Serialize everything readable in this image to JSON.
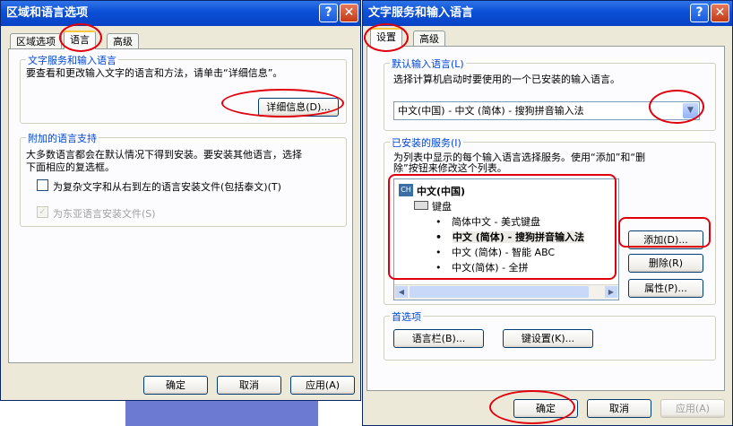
{
  "left_window": {
    "title": "区域和语言选项",
    "help_glyph": "?",
    "close_glyph": "✕",
    "tabs": [
      "区域选项",
      "语言",
      "高级"
    ],
    "group1": {
      "legend": "文字服务和输入语言",
      "desc": "要查看和更改输入文字的语言和方法，请单击“详细信息”。",
      "details_button": "详细信息(D)..."
    },
    "group2": {
      "legend": "附加的语言支持",
      "desc_line1": "大多数语言都会在默认情况下得到安装。要安装其他语言，选择",
      "desc_line2": "下面相应的复选框。",
      "checkbox1": "为复杂文字和从右到左的语言安装文件(包括泰文)(T)",
      "checkbox2": "为东亚语言安装文件(S)"
    },
    "buttons": {
      "ok": "确定",
      "cancel": "取消",
      "apply": "应用(A)"
    }
  },
  "right_window": {
    "title": "文字服务和输入语言",
    "help_glyph": "?",
    "close_glyph": "✕",
    "tabs": [
      "设置",
      "高级"
    ],
    "default_group": {
      "legend": "默认输入语言(L)",
      "desc": "选择计算机启动时要使用的一个已安装的输入语言。",
      "combo_value": "中文(中国) - 中文 (简体) - 搜狗拼音输入法"
    },
    "installed_group": {
      "legend": "已安装的服务(I)",
      "desc_line1": "为列表中显示的每个输入语言选择服务。使用“添加”和“删",
      "desc_line2": "除”按钮来修改这个列表。",
      "tree": {
        "lang_badge": "CH",
        "lang": "中文(中国)",
        "category": "键盘",
        "items": [
          "简体中文 - 美式键盘",
          "中文 (简体) - 搜狗拼音输入法",
          "中文 (简体) - 智能 ABC",
          "中文(简体) - 全拼"
        ],
        "bullet": "•"
      },
      "add_button": "添加(D)...",
      "remove_button": "删除(R)",
      "properties_button": "属性(P)..."
    },
    "prefs_group": {
      "legend": "首选项",
      "langbar_button": "语言栏(B)...",
      "keys_button": "键设置(K)..."
    },
    "buttons": {
      "ok": "确定",
      "cancel": "取消",
      "apply": "应用(A)"
    }
  },
  "colors": {
    "title_bar": "#0a4fd6",
    "window_bg": "#ece9d8",
    "annotation_red": "#e0000b",
    "legend_blue": "#0046d5"
  }
}
